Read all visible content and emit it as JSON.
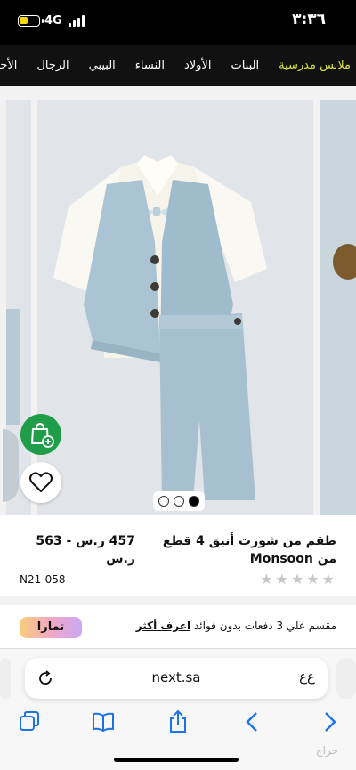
{
  "status_bar": {
    "time": "٣:٣٦",
    "network": "4G"
  },
  "category_nav": {
    "items": [
      "ملابس مدرسية",
      "البنات",
      "الأولاد",
      "النساء",
      "البيبي",
      "الرجال",
      "الأحذية"
    ]
  },
  "gallery": {
    "page_count": 3,
    "active_page": 3
  },
  "product": {
    "title": "طقم من شورت أنيق 4 قطع من Monsoon",
    "price": "457 ر.س - 563 ر.س",
    "code": "N21-058",
    "rating_stars": 5
  },
  "installments": {
    "text": "مقسم علي 3 دفعات بدون فوائد",
    "learn_more": "اعرف أكثر",
    "brand": "تمارا"
  },
  "browser": {
    "url": "next.sa",
    "text_size_label": "ﻉﻉ"
  },
  "watermark": "حراج",
  "colors": {
    "accent_nav": "#d8e13a",
    "bag_green": "#1f9d48",
    "tamara_gradient": [
      "#f8cd7a",
      "#f3a7c5",
      "#c9a9f5"
    ]
  },
  "icons": [
    "battery-icon",
    "signal-icon",
    "shopping-bag-add-icon",
    "heart-icon",
    "reload-icon",
    "tabs-icon",
    "share-icon",
    "book-icon",
    "back-icon",
    "forward-icon"
  ]
}
